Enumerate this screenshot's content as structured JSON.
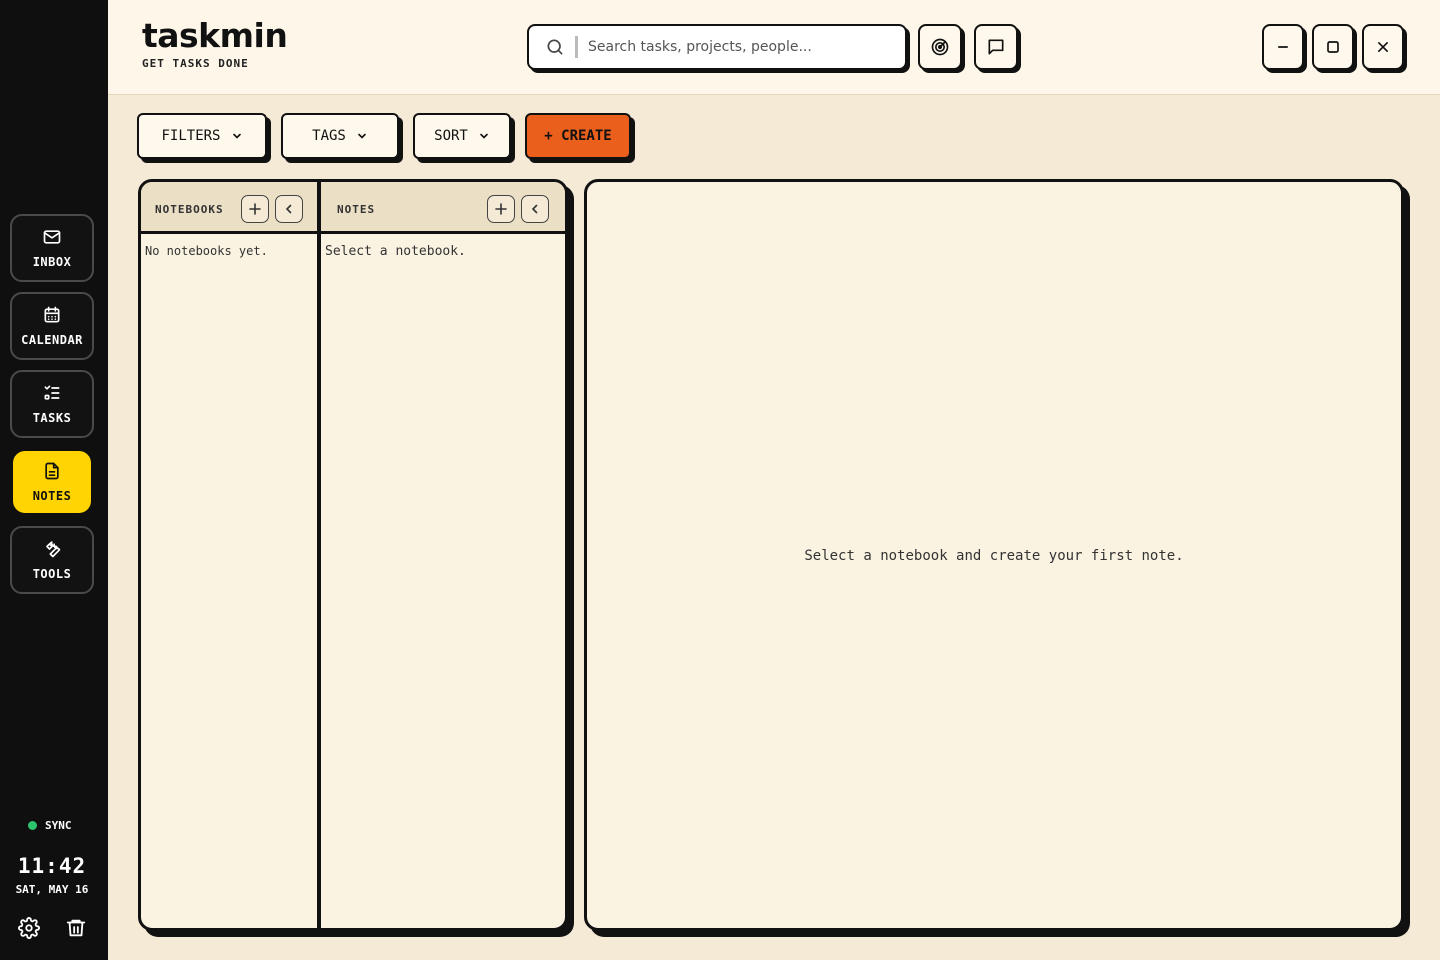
{
  "app": {
    "name": "taskmin",
    "tagline": "GET TASKS DONE"
  },
  "search": {
    "placeholder": "Search tasks, projects, people..."
  },
  "nav": {
    "items": [
      {
        "label": "INBOX",
        "icon": "mail-icon"
      },
      {
        "label": "CALENDAR",
        "icon": "calendar-icon"
      },
      {
        "label": "TASKS",
        "icon": "checklist-icon"
      },
      {
        "label": "NOTES",
        "icon": "document-icon",
        "active": true
      },
      {
        "label": "TOOLS",
        "icon": "wrench-icon"
      }
    ]
  },
  "status": {
    "sync": "SYNC",
    "time": "11:42",
    "date": "SAT, MAY 16"
  },
  "toolbar": {
    "filters": "FILTERS",
    "tags": "TAGS",
    "sort": "SORT",
    "create": "+ CREATE"
  },
  "notebooks": {
    "title": "NOTEBOOKS",
    "empty": "No notebooks yet."
  },
  "notes": {
    "title": "NOTES",
    "empty": "Select a notebook."
  },
  "editor": {
    "empty": "Select a notebook and create your first note."
  },
  "colors": {
    "accent": "#e95f1b",
    "active": "#ffd400",
    "sync": "#2ec46d",
    "sidebar": "#0f0f0f",
    "background": "#f5ead6"
  }
}
